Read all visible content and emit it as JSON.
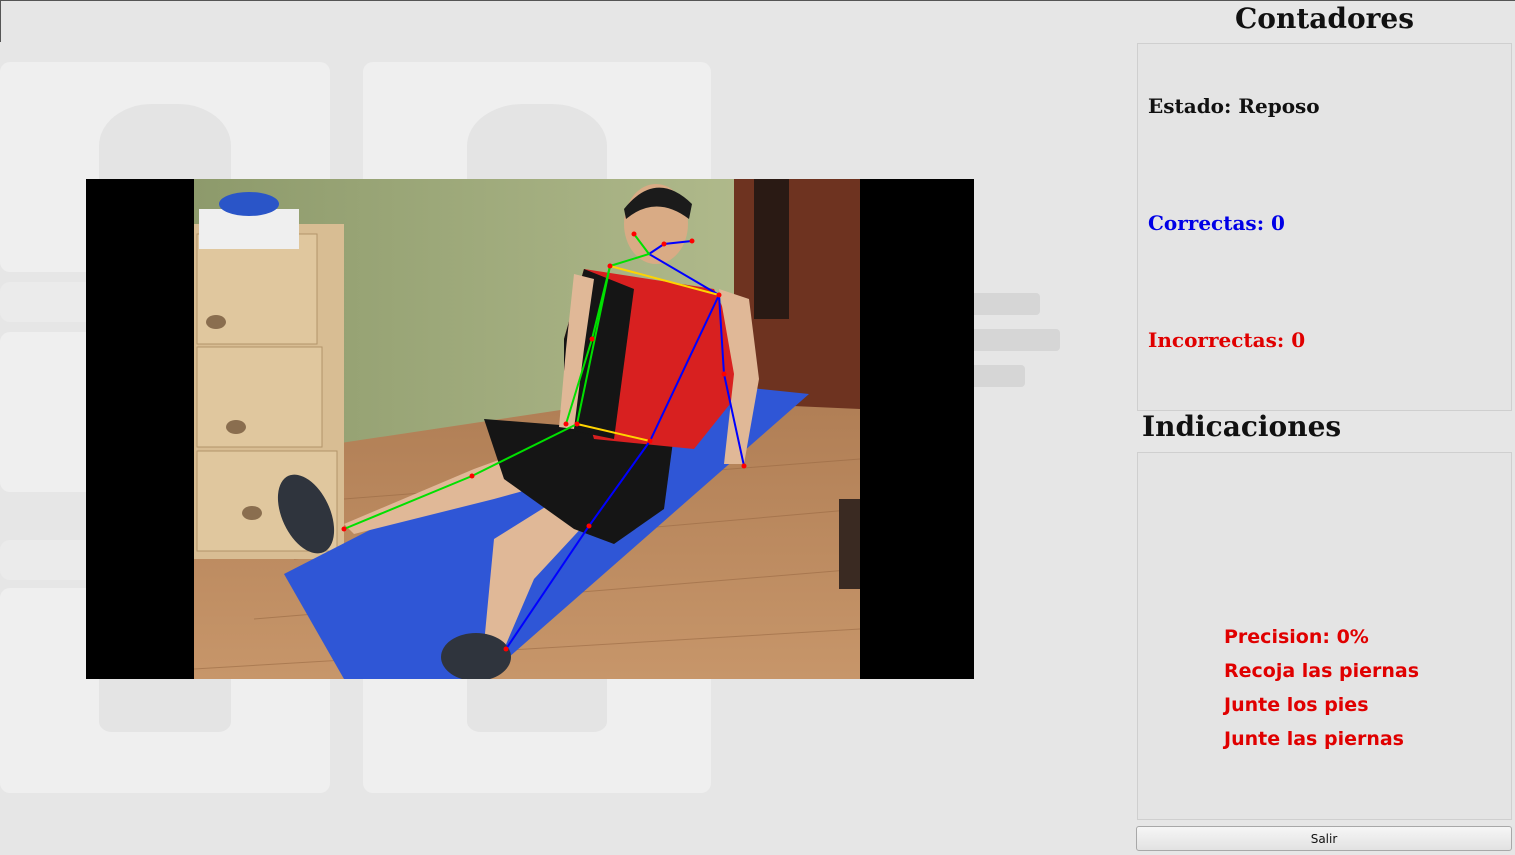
{
  "counters": {
    "title": "Contadores",
    "state_text": "Estado: Reposo",
    "correct_text": "Correctas: 0",
    "incorrect_text": "Incorrectas: 0",
    "colors": {
      "state": "#111111",
      "correct": "#0000e6",
      "incorrect": "#e00000"
    }
  },
  "indications": {
    "title": "Indicaciones",
    "messages": [
      "Precision: 0%",
      "Recoja las piernas",
      "Junte los pies",
      "Junte las piernas"
    ],
    "color": "#e00000"
  },
  "exit_button": {
    "label": "Salir"
  },
  "video": {
    "description_icons": [
      "pose-skeleton-overlay"
    ],
    "skeleton_colors": {
      "left_side": "#00e000",
      "right_side": "#0000ff",
      "torso_lines": "#ffd400",
      "joints": "#ff0000"
    }
  }
}
